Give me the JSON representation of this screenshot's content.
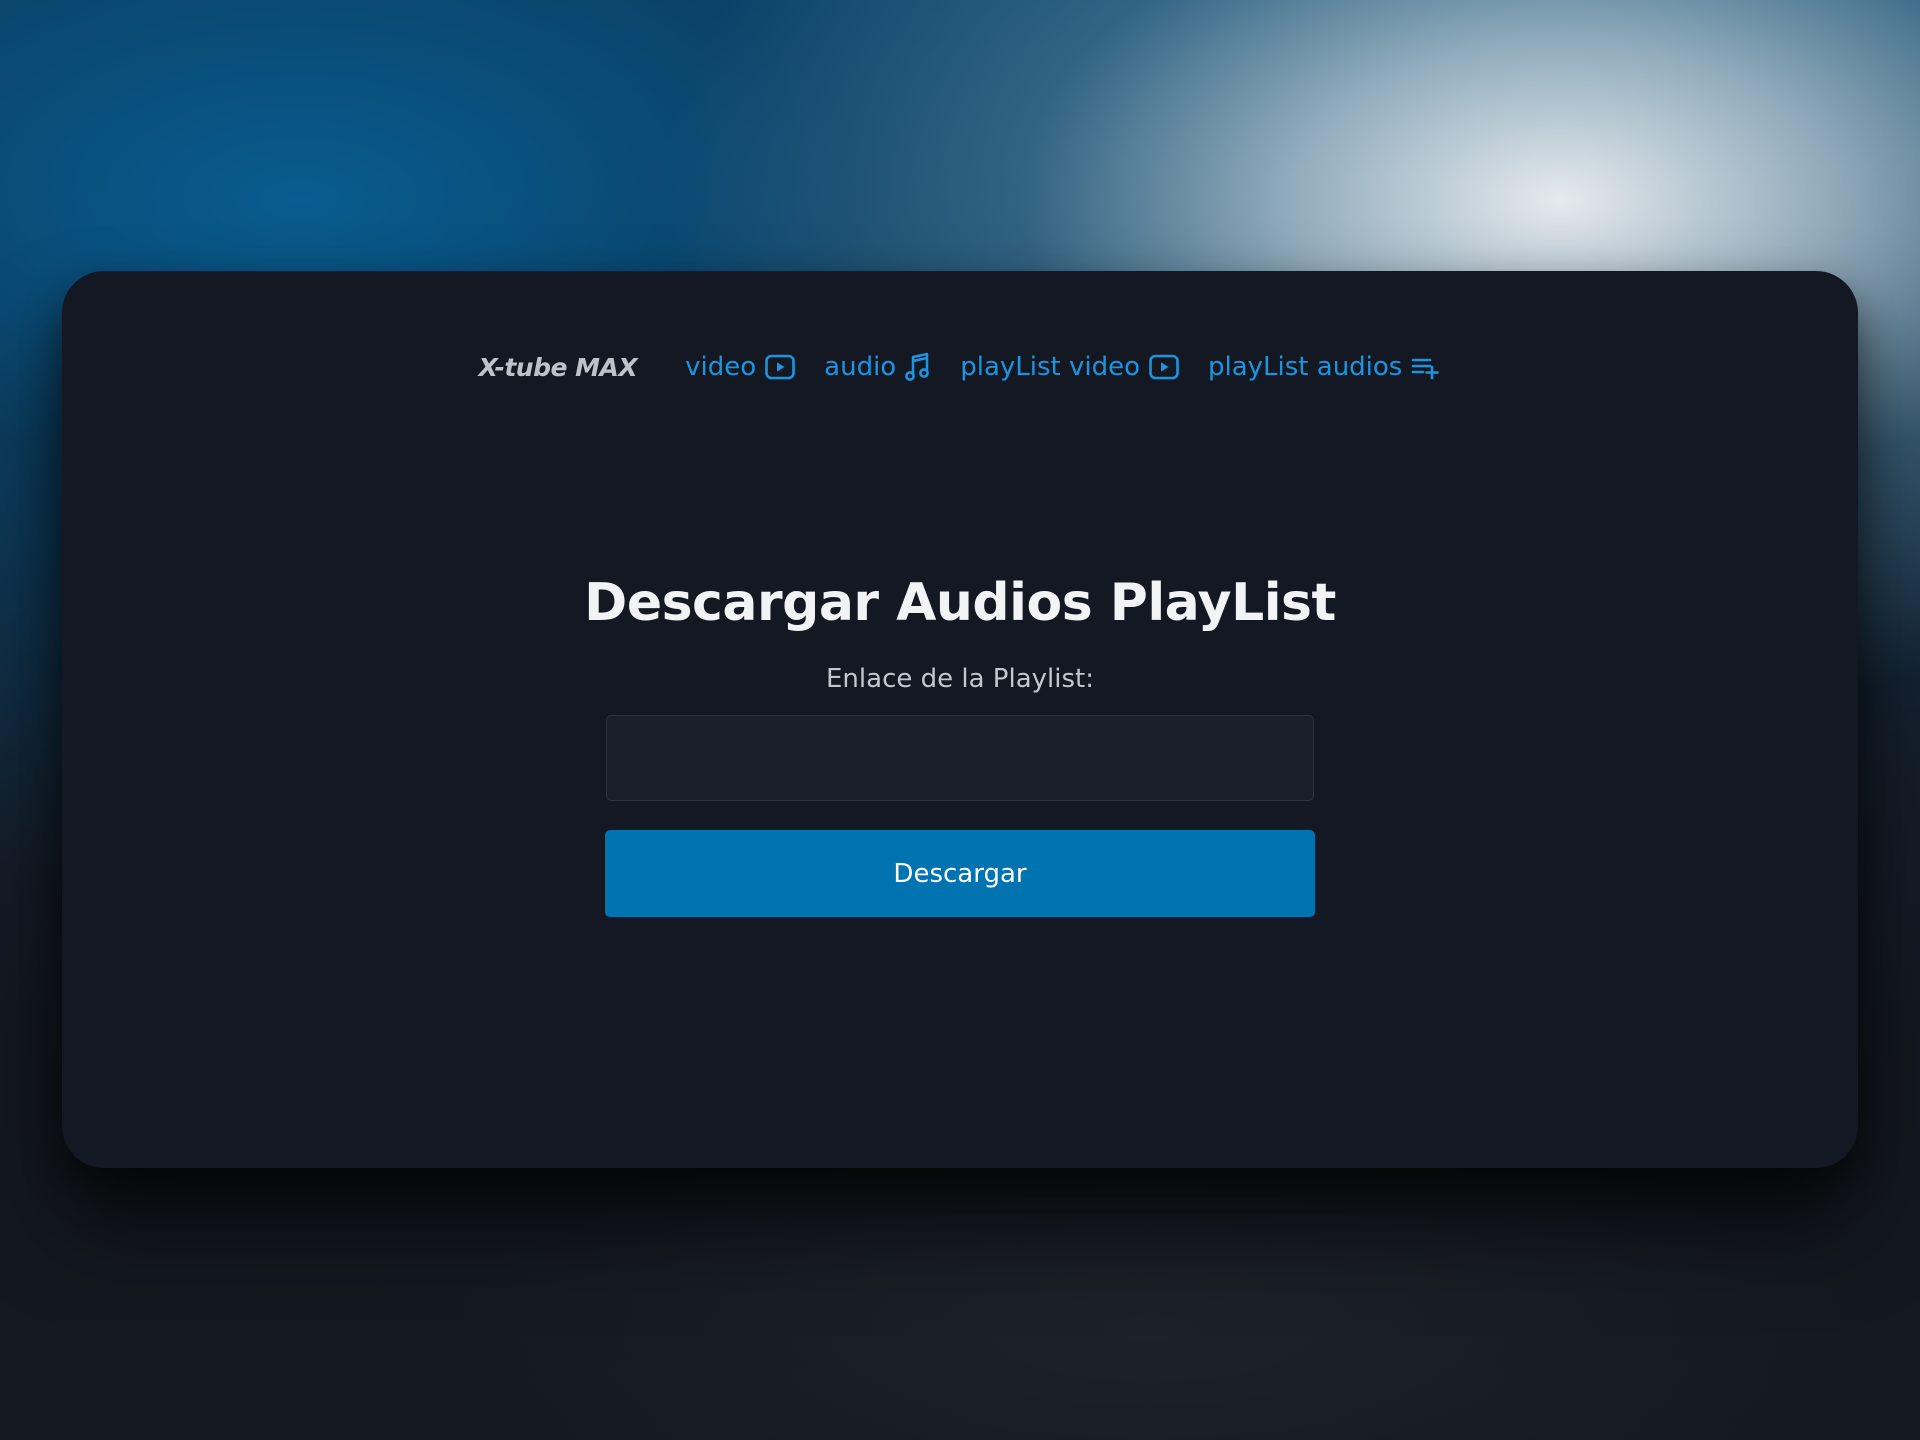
{
  "brand": {
    "name": "X-tube MAX"
  },
  "nav": {
    "items": [
      {
        "label": "video",
        "icon": "play-square-icon"
      },
      {
        "label": "audio",
        "icon": "music-note-icon"
      },
      {
        "label": "playList video",
        "icon": "play-square-icon"
      },
      {
        "label": "playList audios",
        "icon": "playlist-add-icon"
      }
    ]
  },
  "main": {
    "title": "Descargar Audios PlayList",
    "field_label": "Enlace de la Playlist:",
    "input_value": "",
    "button_label": "Descargar"
  },
  "colors": {
    "accent": "#1b95e0",
    "button": "#0173b0",
    "panel": "#131822",
    "input_bg": "#1b1f2a"
  }
}
